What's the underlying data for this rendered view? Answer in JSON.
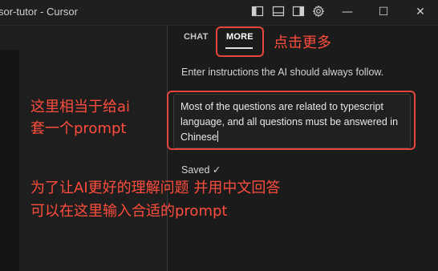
{
  "window": {
    "title": "sor-tutor - Cursor",
    "icons": [
      "toggle-primary-sidebar-icon",
      "toggle-panel-icon",
      "toggle-secondary-sidebar-icon",
      "gear-icon"
    ],
    "controls": {
      "minimize": "—",
      "maximize": "☐",
      "close": "✕"
    }
  },
  "panel": {
    "tabs": [
      {
        "label": "CHAT",
        "active": false
      },
      {
        "label": "MORE",
        "active": true
      }
    ],
    "instructions_label": "Enter instructions the AI should always follow.",
    "instructions_value": "Most of the questions are related to typescript language, and all questions must be answered in Chinese",
    "saved_status": "Saved ✓"
  },
  "annotations": {
    "click_more": "点击更多",
    "prompt_note_line1": "这里相当于给ai",
    "prompt_note_line2": "套一个prompt",
    "tip_line1": "为了让AI更好的理解问题 并用中文回答",
    "tip_line2": "可以在这里输入合适的prompt"
  },
  "colors": {
    "annotation_red": "#e2463e",
    "background": "#1e1e1e"
  }
}
